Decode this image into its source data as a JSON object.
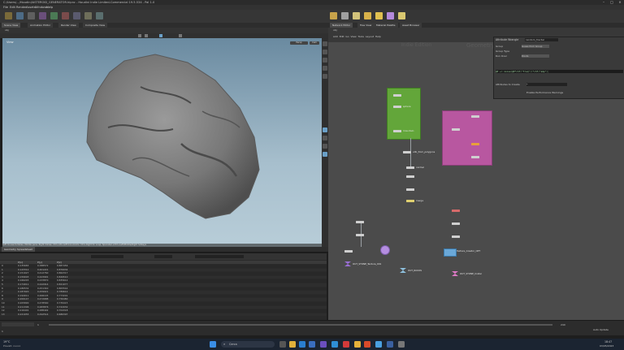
{
  "window": {
    "title": "C:/Users/.../Houdini/ASTEROID_GENERATOR.hipnc - Houdini Indie Limited-Commercial 19.5.534 - Pal 1.0"
  },
  "menu": [
    "File",
    "Edit",
    "Render",
    "Assets",
    "Windows",
    "Help"
  ],
  "left_tabs": [
    "Scene View",
    "Animation Editor",
    "Render View",
    "Composite View"
  ],
  "right_tabs": [
    "Network Editor",
    "Tree View",
    "Material Palette",
    "Asset Browser"
  ],
  "viewport": {
    "label": "View",
    "status": "Left mouse tumbles. Middle pans. Right dollies. Ctrl+Alt+Left box-zooms. Ctrl+Right for snap. Spacebar+Ctrl+Left/Middle/Right hotkeys"
  },
  "network": {
    "path": "obj",
    "geo_label": "Geometry",
    "viewer_label": "Indie Edition",
    "nodes": [
      {
        "name": "asteroid_base"
      },
      {
        "name": "sphere"
      },
      {
        "name": "mountain"
      },
      {
        "name": "attribvoronoi"
      },
      {
        "name": "scatter"
      },
      {
        "name": "voronoi_fracture"
      },
      {
        "name": "rock_subdivide"
      },
      {
        "name": "vdb_from_polygons"
      },
      {
        "name": "normal"
      },
      {
        "name": "merge"
      },
      {
        "name": "OUT_STONE_Texture_001"
      },
      {
        "name": "OUT_ROCKS"
      },
      {
        "name": "Texture_Creator_OPT"
      },
      {
        "name": "OUT_STONE_Crater"
      }
    ]
  },
  "params": {
    "node_type": "Attribute Wrangle",
    "node_name": "random_fractal",
    "labels": [
      "Group",
      "Group Type",
      "Run Over",
      "Attributes to Create",
      "Enable Performance Warnings"
    ],
    "values": [
      "Guess from Group",
      "Points",
      "*"
    ],
    "code": "@P += noise(@P*chf(\"freq\"))*chf(\"amp\");"
  },
  "spreadsheet": {
    "columns": [
      "",
      "P[x]",
      "P[y]",
      "P[z]"
    ],
    "rows": [
      [
        "0",
        "0.135683",
        "0.388572",
        "0.887456"
      ],
      [
        "1",
        "0.143312",
        "0.401221",
        "0.876034"
      ],
      [
        "2",
        "0.151027",
        "0.412760",
        "0.862317"
      ],
      [
        "3",
        "0.159003",
        "0.423991",
        "0.849510"
      ],
      [
        "4",
        "0.166245",
        "0.433870",
        "0.835612"
      ],
      [
        "5",
        "0.174011",
        "0.442914",
        "0.821077"
      ],
      [
        "6",
        "0.180532",
        "0.451340",
        "0.805544"
      ],
      [
        "7",
        "0.187920",
        "0.459021",
        "0.789612"
      ],
      [
        "8",
        "0.194011",
        "0.466145",
        "0.773201"
      ],
      [
        "9",
        "0.200147",
        "0.472688",
        "0.756480"
      ],
      [
        "10",
        "0.205890",
        "0.478560",
        "0.739415"
      ],
      [
        "11",
        "0.211306",
        "0.483876",
        "0.722032"
      ],
      [
        "12",
        "0.216401",
        "0.488492",
        "0.704318"
      ],
      [
        "13",
        "0.221055",
        "0.492514",
        "0.686397"
      ]
    ]
  },
  "timeline": {
    "frame": "1",
    "start": "1",
    "end": "240",
    "realtime": "Auto Update"
  },
  "taskbar": {
    "weather_temp": "19°C",
    "weather_text": "Prevalt. nuvol.",
    "search": "Cerca",
    "time": "18:47",
    "date": "03/05/2023"
  }
}
